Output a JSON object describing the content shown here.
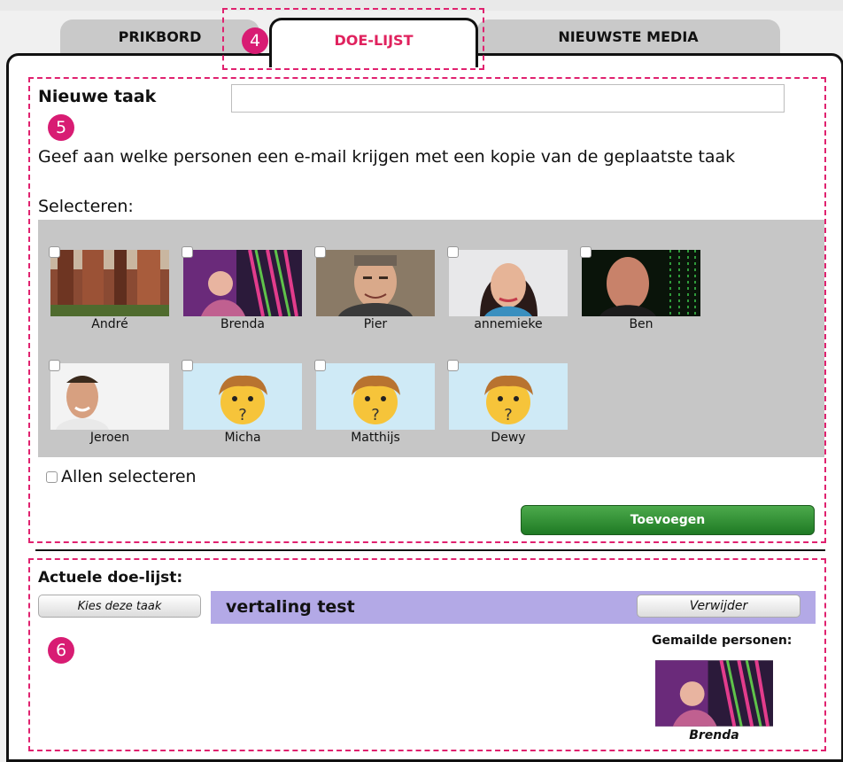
{
  "tabs": [
    {
      "label": "PRIKBORD",
      "active": false
    },
    {
      "label": "DOE-LIJST",
      "active": true
    },
    {
      "label": "NIEUWSTE MEDIA",
      "active": false
    }
  ],
  "annotations": [
    "4",
    "5",
    "6"
  ],
  "new_task": {
    "label": "Nieuwe taak",
    "value": "",
    "placeholder": ""
  },
  "email_instruction": "Geef aan welke personen een e-mail krijgen met een kopie van de geplaatste taak",
  "select_label": "Selecteren:",
  "people": [
    {
      "name": "André",
      "icon": "forest-photo",
      "checked": false
    },
    {
      "name": "Brenda",
      "icon": "person-photo",
      "checked": false
    },
    {
      "name": "Pier",
      "icon": "person-photo",
      "checked": false
    },
    {
      "name": "annemieke",
      "icon": "person-photo",
      "checked": false
    },
    {
      "name": "Ben",
      "icon": "person-photo",
      "checked": false
    },
    {
      "name": "Jeroen",
      "icon": "person-photo",
      "checked": false
    },
    {
      "name": "Micha",
      "icon": "default-avatar",
      "checked": false
    },
    {
      "name": "Matthijs",
      "icon": "default-avatar",
      "checked": false
    },
    {
      "name": "Dewy",
      "icon": "default-avatar",
      "checked": false
    }
  ],
  "select_all_label": "Allen selecteren",
  "add_button": "Toevoegen",
  "current_list_label": "Actuele doe-lijst:",
  "tasks": [
    {
      "choose_button": "Kies deze taak",
      "title": "vertaling test",
      "delete_button": "Verwijder",
      "emailed_label": "Gemailde personen:",
      "emailed_people": [
        {
          "name": "Brenda"
        }
      ]
    }
  ],
  "colors": {
    "accent": "#e0225e",
    "annotation": "#d81c73",
    "add_button": "#2e8b35",
    "task_bar": "#b3a9e6"
  }
}
